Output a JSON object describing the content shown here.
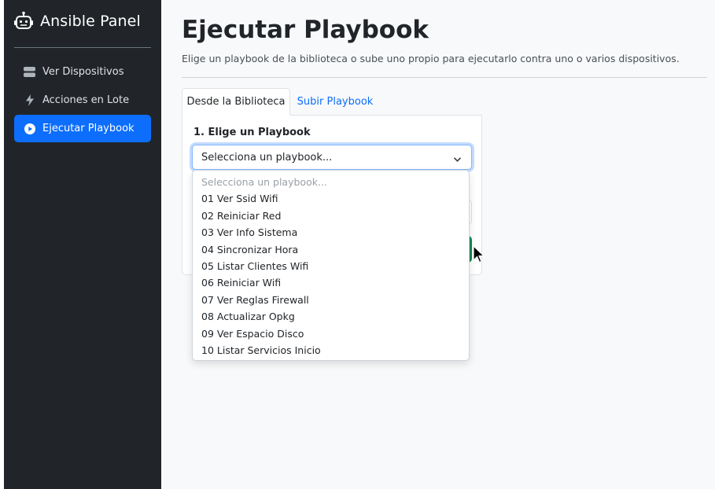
{
  "app": {
    "brand": "Ansible Panel",
    "brand_icon": "robot-icon"
  },
  "sidebar": {
    "items": [
      {
        "label": "Ver Dispositivos",
        "icon": "server-icon",
        "active": false
      },
      {
        "label": "Acciones en Lote",
        "icon": "lightning-icon",
        "active": false
      },
      {
        "label": "Ejecutar Playbook",
        "icon": "play-circle-icon",
        "active": true
      }
    ]
  },
  "page": {
    "title": "Ejecutar Playbook",
    "subtitle": "Elige un playbook de la biblioteca o sube uno propio para ejecutarlo contra uno o varios dispositivos."
  },
  "tabs": [
    {
      "label": "Desde la Biblioteca",
      "active": true
    },
    {
      "label": "Subir Playbook",
      "active": false
    }
  ],
  "form": {
    "label": "1. Elige un Playbook",
    "selected": "Selecciona un playbook..."
  },
  "dropdown": {
    "placeholder": "Selecciona un playbook...",
    "options": [
      "01 Ver Ssid Wifi",
      "02 Reiniciar Red",
      "03 Ver Info Sistema",
      "04 Sincronizar Hora",
      "05 Listar Clientes Wifi",
      "06 Reiniciar Wifi",
      "07 Ver Reglas Firewall",
      "08 Actualizar Opkg",
      "09 Ver Espacio Disco",
      "10 Listar Servicios Inicio"
    ]
  },
  "colors": {
    "sidebar_bg": "#212529",
    "accent": "#0d6efd",
    "success": "#198754",
    "page_bg": "#f8f9fa"
  }
}
